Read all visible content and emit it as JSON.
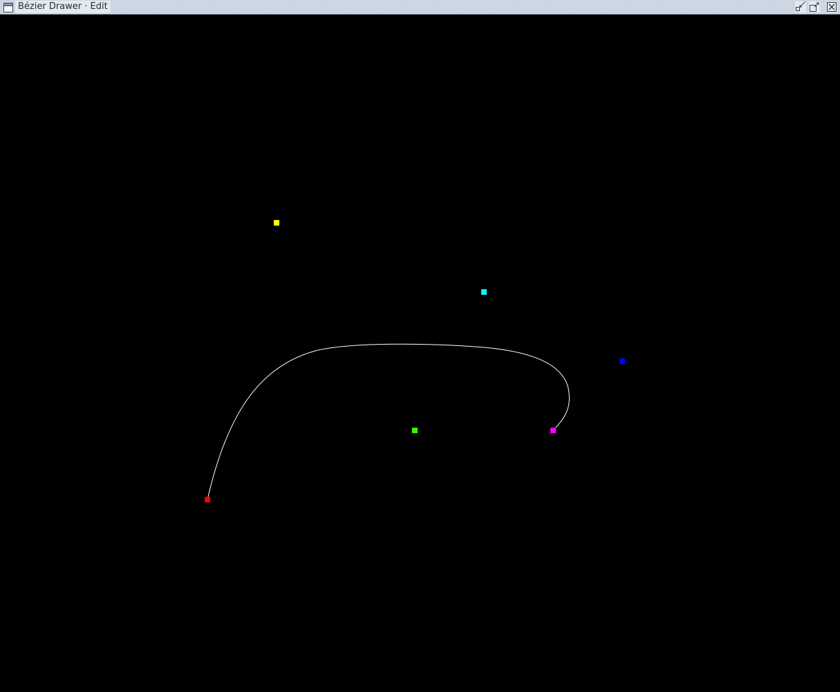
{
  "window": {
    "title": "Bézier Drawer · Edit"
  },
  "titlebar_buttons": [
    {
      "name": "iconify-button",
      "icon": "window-iconify-icon"
    },
    {
      "name": "maximize-button",
      "icon": "window-maximize-icon"
    },
    {
      "name": "close-button",
      "icon": "window-close-icon"
    }
  ],
  "canvas": {
    "background_color": "#000000",
    "curve_color": "#ffffff",
    "control_points": [
      {
        "name": "control-point-red",
        "color": "#ff0000"
      },
      {
        "name": "control-point-yellow",
        "color": "#ffff00"
      },
      {
        "name": "control-point-green",
        "color": "#33ff00"
      },
      {
        "name": "control-point-cyan",
        "color": "#00ffff"
      },
      {
        "name": "control-point-blue",
        "color": "#0000ff"
      },
      {
        "name": "control-point-magenta",
        "color": "#ff00ff"
      }
    ]
  }
}
